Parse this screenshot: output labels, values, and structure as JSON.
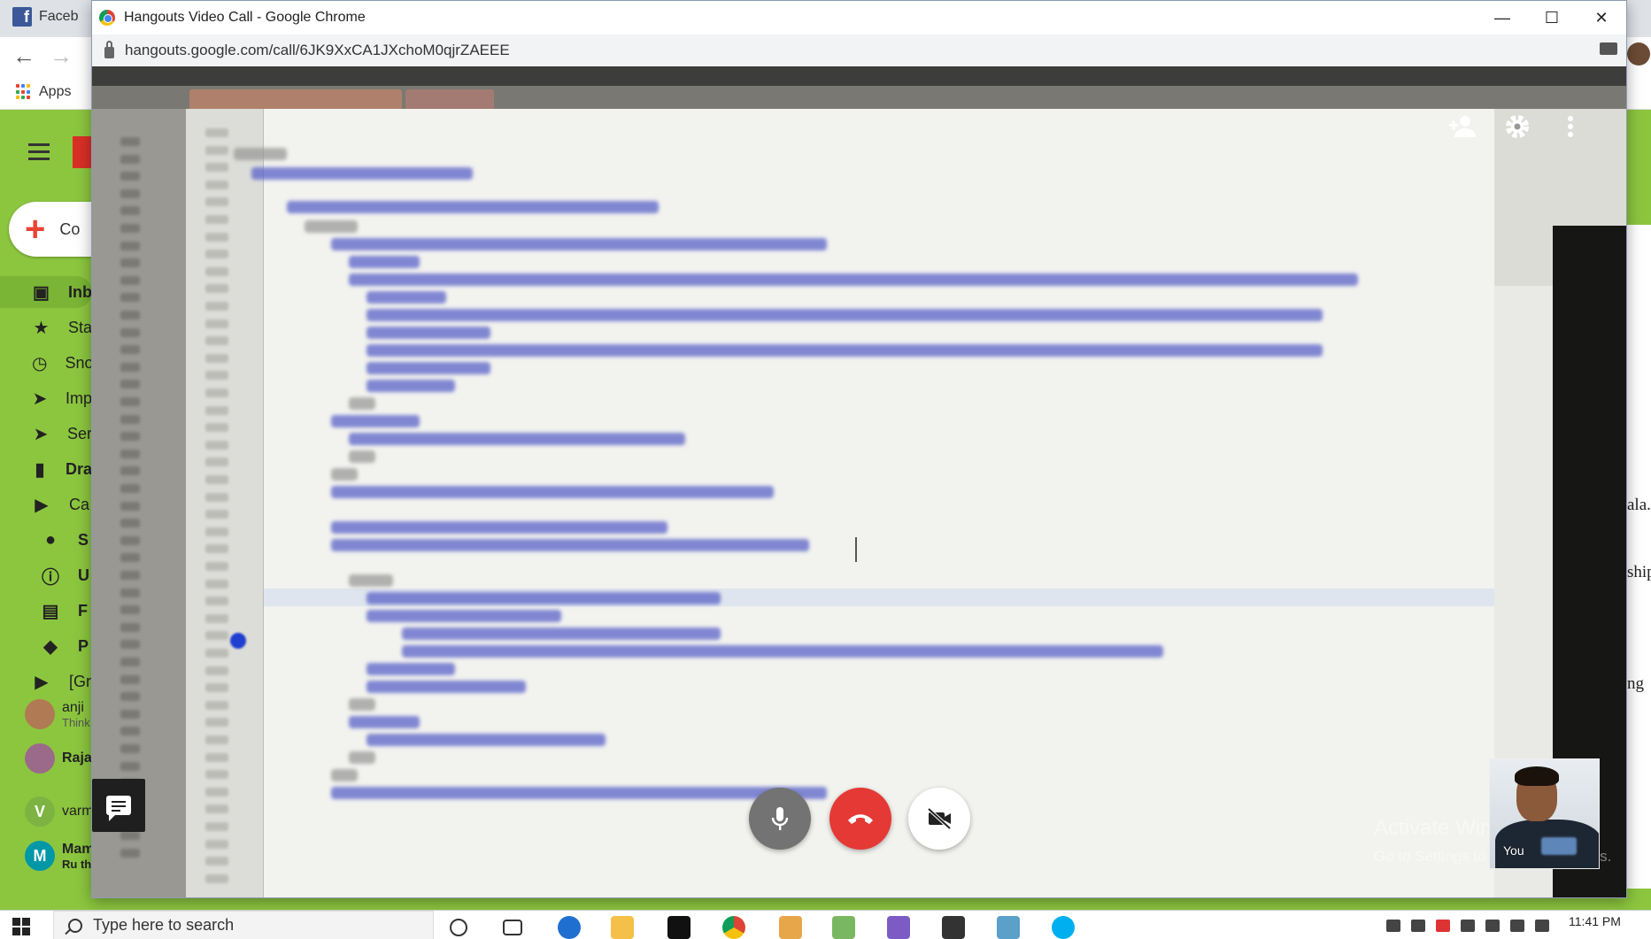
{
  "background_browser": {
    "tab_label": "Faceb",
    "bookmark_apps_label": "Apps",
    "compose_label": "Co",
    "sidebar": [
      {
        "label": "Inb",
        "icon": "inbox-icon",
        "active": true
      },
      {
        "label": "Sta",
        "icon": "star-icon"
      },
      {
        "label": "Sno",
        "icon": "clock-icon"
      },
      {
        "label": "Imp",
        "icon": "important-icon"
      },
      {
        "label": "Ser",
        "icon": "send-icon"
      },
      {
        "label": "Dra",
        "icon": "draft-icon"
      },
      {
        "label": "Ca",
        "icon": "label-icon"
      },
      {
        "label": "S",
        "icon": "people-icon"
      },
      {
        "label": "U",
        "icon": "info-icon"
      },
      {
        "label": "F",
        "icon": "forum-icon"
      },
      {
        "label": "P",
        "icon": "tag-icon"
      },
      {
        "label": "[Gr",
        "icon": "label-icon"
      }
    ],
    "contacts": [
      {
        "name": "anji",
        "status": "Think"
      },
      {
        "name": "Raja",
        "status": ""
      },
      {
        "name": "varm",
        "status": "",
        "initial": "V"
      },
      {
        "name": "Mam",
        "status": "Ru th",
        "initial": "M"
      }
    ],
    "right_edge_text": [
      "ala.",
      "ship",
      "ng"
    ]
  },
  "hangouts": {
    "window_title": "Hangouts Video Call - Google Chrome",
    "url": "hangouts.google.com/call/6JK9XxCA1JXchoM0qjrZAEEE",
    "self_view_label": "You",
    "controls": {
      "mic": "microphone-icon",
      "end_call": "hang-up-icon",
      "camera": "camera-off-icon",
      "chat": "chat-icon",
      "add_person": "add-person-icon",
      "settings": "gear-icon",
      "more": "more-vert-icon"
    },
    "accent_colors": {
      "end_call": "#e53935",
      "mic_bg": "#737373",
      "camera_bg": "#ffffff"
    }
  },
  "watermark": {
    "line1": "Activate Windows",
    "line2": "Go to Settings to activate Windows."
  },
  "taskbar": {
    "search_placeholder": "Type here to search",
    "clock": "11:41 PM"
  }
}
